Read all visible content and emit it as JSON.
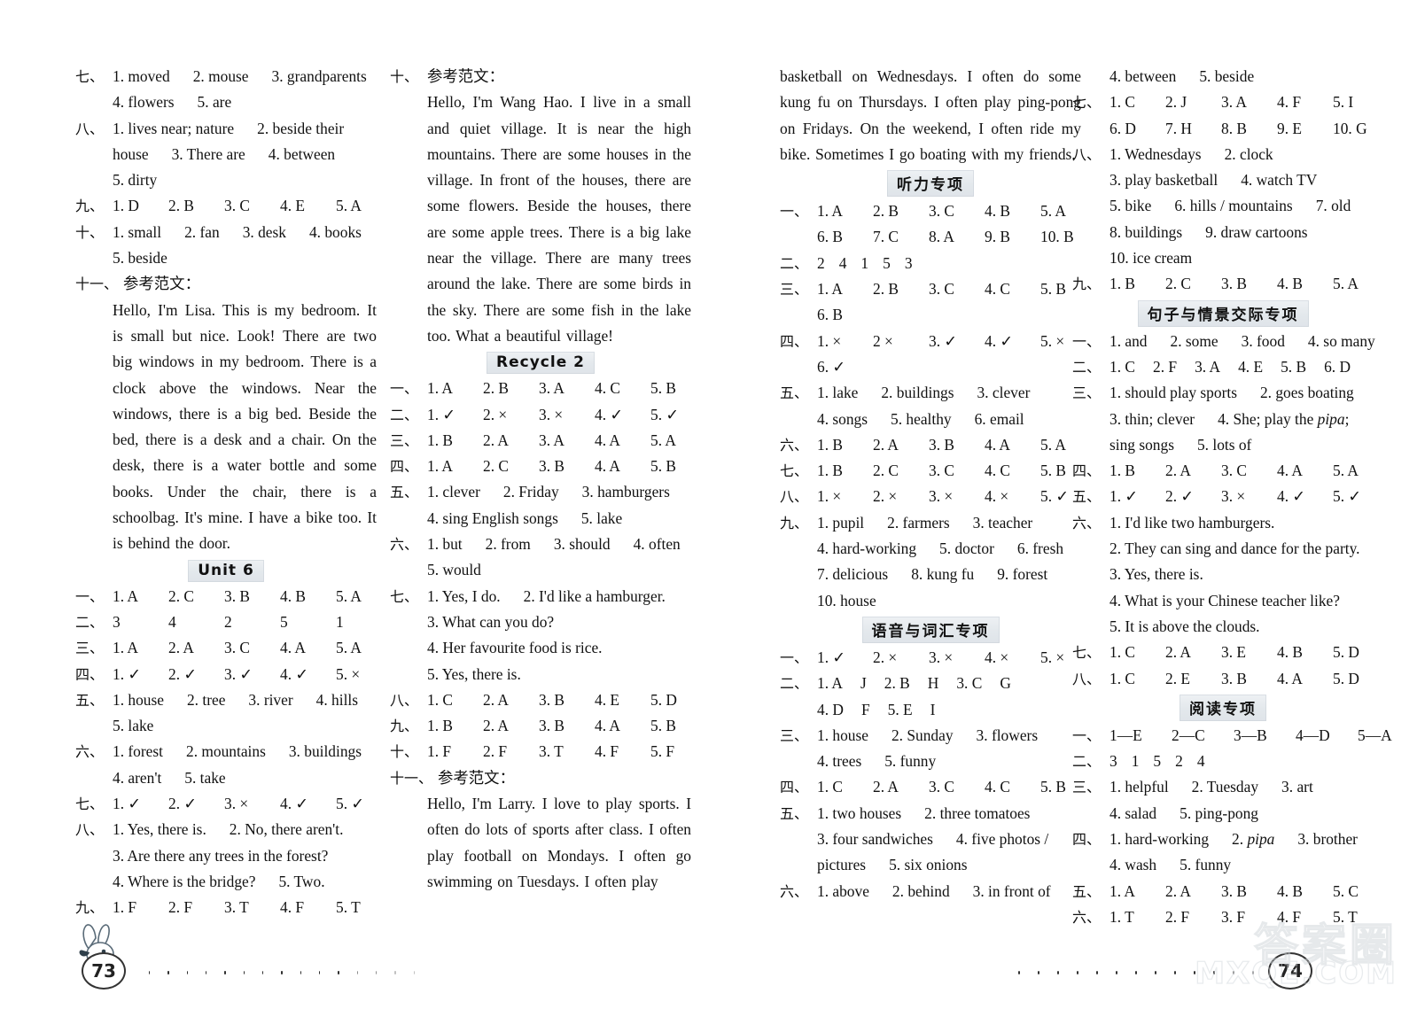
{
  "document": {
    "type": "answer-key",
    "page_left": "73",
    "page_right": "74",
    "watermark_cn": "答案圈",
    "watermark_en": "MXQE.COM"
  },
  "col1": {
    "blocks": [
      {
        "num": "七、",
        "items": [
          "1. moved",
          "2. mouse",
          "3. grandparents"
        ],
        "spacing": "free"
      },
      {
        "cont": true,
        "items": [
          "4. flowers",
          "5. are"
        ],
        "spacing": "free"
      },
      {
        "num": "八、",
        "items": [
          "1. lives near; nature",
          "2. beside their"
        ],
        "spacing": "free"
      },
      {
        "cont": true,
        "items": [
          "house",
          "3. There are",
          "4. between"
        ],
        "spacing": "free"
      },
      {
        "cont": true,
        "items": [
          "5. dirty"
        ],
        "spacing": "free"
      },
      {
        "num": "九、",
        "items": [
          "1. D",
          "2. B",
          "3. C",
          "4. E",
          "5. A"
        ],
        "spacing": "sp5"
      },
      {
        "num": "十、",
        "items": [
          "1. small",
          "2. fan",
          "3. desk",
          "4. books"
        ],
        "spacing": "free"
      },
      {
        "cont": true,
        "items": [
          "5. beside"
        ],
        "spacing": "free"
      },
      {
        "num": "十一、",
        "items": [
          "参考范文："
        ],
        "spacing": "free",
        "wide": true
      }
    ],
    "essay": "Hello, I'm Lisa. This is my bedroom. It is small but nice. Look! There are two big windows in my bedroom. There is a clock above the windows. Near the windows, there is a big bed. Beside the bed, there is a desk and a chair. On the desk, there is a water bottle and some books. Under the chair, there is a schoolbag. It's mine. I have a bike too. It is behind the door.",
    "heading": "Unit 6",
    "blocks2": [
      {
        "num": "一、",
        "items": [
          "1. A",
          "2. C",
          "3. B",
          "4. B",
          "5. A"
        ],
        "spacing": "sp5"
      },
      {
        "num": "二、",
        "items": [
          "3",
          "4",
          "2",
          "5",
          "1"
        ],
        "spacing": "sp5"
      },
      {
        "num": "三、",
        "items": [
          "1. A",
          "2. A",
          "3. C",
          "4. A",
          "5. A"
        ],
        "spacing": "sp5"
      },
      {
        "num": "四、",
        "items": [
          "1. ✓",
          "2. ✓",
          "3. ✓",
          "4. ✓",
          "5. ×"
        ],
        "spacing": "sp5"
      },
      {
        "num": "五、",
        "items": [
          "1. house",
          "2. tree",
          "3. river",
          "4. hills"
        ],
        "spacing": "free"
      },
      {
        "cont": true,
        "items": [
          "5. lake"
        ],
        "spacing": "free"
      },
      {
        "num": "六、",
        "items": [
          "1. forest",
          "2. mountains",
          "3. buildings"
        ],
        "spacing": "free"
      },
      {
        "cont": true,
        "items": [
          "4. aren't",
          "5. take"
        ],
        "spacing": "free"
      },
      {
        "num": "七、",
        "items": [
          "1. ✓",
          "2. ✓",
          "3. ×",
          "4. ✓",
          "5. ✓"
        ],
        "spacing": "sp5"
      },
      {
        "num": "八、",
        "items": [
          "1. Yes, there is.",
          "2. No, there aren't."
        ],
        "spacing": "free"
      },
      {
        "cont": true,
        "items": [
          "3. Are there any trees in the forest?"
        ],
        "spacing": "free"
      },
      {
        "cont": true,
        "items": [
          "4. Where is the bridge?",
          "5. Two."
        ],
        "spacing": "free"
      },
      {
        "num": "九、",
        "items": [
          "1. F",
          "2. F",
          "3. T",
          "4. F",
          "5. T"
        ],
        "spacing": "sp5"
      }
    ]
  },
  "col2": {
    "blocks": [
      {
        "num": "十、",
        "items": [
          "参考范文："
        ],
        "spacing": "free"
      }
    ],
    "essay": "Hello, I'm Wang Hao. I live in a small and quiet village. It is near the high mountains. There are some houses in the village. In front of the houses, there are some flowers. Beside the houses, there are some apple trees. There is a big lake near the village. There are many trees around the lake. There are some birds in the sky. There are some fish in the lake too. What a beautiful village!",
    "heading": "Recycle 2",
    "blocks2": [
      {
        "num": "一、",
        "items": [
          "1. A",
          "2. B",
          "3. A",
          "4. C",
          "5. B"
        ],
        "spacing": "sp5"
      },
      {
        "num": "二、",
        "items": [
          "1. ✓",
          "2. ×",
          "3. ×",
          "4. ✓",
          "5. ✓"
        ],
        "spacing": "sp5"
      },
      {
        "num": "三、",
        "items": [
          "1. B",
          "2. A",
          "3. A",
          "4. A",
          "5. A"
        ],
        "spacing": "sp5"
      },
      {
        "num": "四、",
        "items": [
          "1. A",
          "2. C",
          "3. B",
          "4. A",
          "5. B"
        ],
        "spacing": "sp5"
      },
      {
        "num": "五、",
        "items": [
          "1. clever",
          "2. Friday",
          "3. hamburgers"
        ],
        "spacing": "free"
      },
      {
        "cont": true,
        "items": [
          "4. sing English songs",
          "5. lake"
        ],
        "spacing": "free"
      },
      {
        "num": "六、",
        "items": [
          "1. but",
          "2. from",
          "3. should",
          "4. often"
        ],
        "spacing": "free"
      },
      {
        "cont": true,
        "items": [
          "5. would"
        ],
        "spacing": "free"
      },
      {
        "num": "七、",
        "items": [
          "1. Yes, I do.",
          "2. I'd like a hamburger."
        ],
        "spacing": "free"
      },
      {
        "cont": true,
        "items": [
          "3. What can you do?"
        ],
        "spacing": "free"
      },
      {
        "cont": true,
        "items": [
          "4. Her favourite food is rice."
        ],
        "spacing": "free"
      },
      {
        "cont": true,
        "items": [
          "5. Yes, there is."
        ],
        "spacing": "free"
      },
      {
        "num": "八、",
        "items": [
          "1. C",
          "2. A",
          "3. B",
          "4. E",
          "5. D"
        ],
        "spacing": "sp5"
      },
      {
        "num": "九、",
        "items": [
          "1. B",
          "2. A",
          "3. B",
          "4. A",
          "5. B"
        ],
        "spacing": "sp5"
      },
      {
        "num": "十、",
        "items": [
          "1. F",
          "2. F",
          "3. T",
          "4. F",
          "5. F"
        ],
        "spacing": "sp5"
      },
      {
        "num": "十一、",
        "items": [
          "参考范文："
        ],
        "spacing": "free",
        "wide": true
      }
    ],
    "essay2": "Hello, I'm Larry. I love to play sports. I often do lots of sports after class. I often play football on Mondays. I often go swimming on Tuesdays. I often play"
  },
  "col3": {
    "essay_cont": "basketball on Wednesdays. I often do some kung fu on Thursdays. I often play ping-pong on Fridays. On the weekend, I often ride my bike. Sometimes I go boating with my friends.",
    "heading1": "听力专项",
    "blocks": [
      {
        "num": "一、",
        "items": [
          "1. A",
          "2. B",
          "3. C",
          "4. B",
          "5. A"
        ],
        "spacing": "sp5"
      },
      {
        "cont": true,
        "items": [
          "6. B",
          "7. C",
          "8. A",
          "9. B",
          "10. B"
        ],
        "spacing": "sp5"
      },
      {
        "num": "二、",
        "items": [
          "2",
          "4",
          "1",
          "5",
          "3"
        ],
        "spacing": "tight"
      },
      {
        "num": "三、",
        "items": [
          "1. A",
          "2. B",
          "3. C",
          "4. C",
          "5. B"
        ],
        "spacing": "sp5"
      },
      {
        "cont": true,
        "items": [
          "6. B"
        ],
        "spacing": "free"
      },
      {
        "num": "四、",
        "items": [
          "1. ×",
          "2 ×",
          "3. ✓",
          "4. ✓",
          "5. ×"
        ],
        "spacing": "sp5"
      },
      {
        "cont": true,
        "items": [
          "6. ✓"
        ],
        "spacing": "free"
      },
      {
        "num": "五、",
        "items": [
          "1. lake",
          "2. buildings",
          "3. clever"
        ],
        "spacing": "free"
      },
      {
        "cont": true,
        "items": [
          "4. songs",
          "5. healthy",
          "6. email"
        ],
        "spacing": "free"
      },
      {
        "num": "六、",
        "items": [
          "1. B",
          "2. A",
          "3. B",
          "4. A",
          "5. A"
        ],
        "spacing": "sp5"
      },
      {
        "num": "七、",
        "items": [
          "1. B",
          "2. C",
          "3. C",
          "4. C",
          "5. B"
        ],
        "spacing": "sp5"
      },
      {
        "num": "八、",
        "items": [
          "1. ×",
          "2. ×",
          "3. ×",
          "4. ×",
          "5. ✓"
        ],
        "spacing": "sp5"
      },
      {
        "num": "九、",
        "items": [
          "1. pupil",
          "2. farmers",
          "3. teacher"
        ],
        "spacing": "free"
      },
      {
        "cont": true,
        "items": [
          "4. hard-working",
          "5. doctor",
          "6. fresh"
        ],
        "spacing": "free"
      },
      {
        "cont": true,
        "items": [
          "7. delicious",
          "8. kung fu",
          "9. forest"
        ],
        "spacing": "free"
      },
      {
        "cont": true,
        "items": [
          "10. house"
        ],
        "spacing": "free"
      }
    ],
    "heading2": "语音与词汇专项",
    "blocks2": [
      {
        "num": "一、",
        "items": [
          "1. ✓",
          "2. ×",
          "3. ×",
          "4. ×",
          "5. ×"
        ],
        "spacing": "sp5"
      },
      {
        "num": "二、",
        "items": [
          "1. A",
          "J",
          "2. B",
          "H",
          "3. C",
          "G"
        ],
        "spacing": "free2"
      },
      {
        "cont": true,
        "items": [
          "4. D",
          "F",
          "5. E",
          "I"
        ],
        "spacing": "free2"
      },
      {
        "num": "三、",
        "items": [
          "1. house",
          "2. Sunday",
          "3. flowers"
        ],
        "spacing": "free"
      },
      {
        "cont": true,
        "items": [
          "4. trees",
          "5. funny"
        ],
        "spacing": "free"
      },
      {
        "num": "四、",
        "items": [
          "1. C",
          "2. A",
          "3. C",
          "4. C",
          "5. B"
        ],
        "spacing": "sp5"
      },
      {
        "num": "五、",
        "items": [
          "1. two houses",
          "2. three tomatoes"
        ],
        "spacing": "free"
      },
      {
        "cont": true,
        "items": [
          "3. four sandwiches",
          "4. five photos /"
        ],
        "spacing": "free"
      },
      {
        "cont": true,
        "items": [
          "pictures",
          "5. six onions"
        ],
        "spacing": "free"
      },
      {
        "num": "六、",
        "items": [
          "1. above",
          "2. behind",
          "3. in front of"
        ],
        "spacing": "free"
      }
    ]
  },
  "col4": {
    "blocks": [
      {
        "cont": true,
        "items": [
          "4. between",
          "5. beside"
        ],
        "spacing": "free"
      },
      {
        "num": "七、",
        "items": [
          "1. C",
          "2. J",
          "3. A",
          "4. F",
          "5. I"
        ],
        "spacing": "sp5"
      },
      {
        "cont": true,
        "items": [
          "6. D",
          "7. H",
          "8. B",
          "9. E",
          "10. G"
        ],
        "spacing": "sp5"
      },
      {
        "num": "八、",
        "items": [
          "1. Wednesdays",
          "2. clock"
        ],
        "spacing": "free"
      },
      {
        "cont": true,
        "items": [
          "3. play basketball",
          "4. watch TV"
        ],
        "spacing": "free"
      },
      {
        "cont": true,
        "items": [
          "5. bike",
          "6. hills / mountains",
          "7. old"
        ],
        "spacing": "free"
      },
      {
        "cont": true,
        "items": [
          "8. buildings",
          "9. draw cartoons"
        ],
        "spacing": "free"
      },
      {
        "cont": true,
        "items": [
          "10. ice cream"
        ],
        "spacing": "free"
      },
      {
        "num": "九、",
        "items": [
          "1. B",
          "2. C",
          "3. B",
          "4. B",
          "5. A"
        ],
        "spacing": "sp5"
      }
    ],
    "heading1": "句子与情景交际专项",
    "blocks2": [
      {
        "num": "一、",
        "items": [
          "1. and",
          "2. some",
          "3. food",
          "4. so many"
        ],
        "spacing": "free"
      },
      {
        "num": "二、",
        "items": [
          "1. C",
          "2. F",
          "3. A",
          "4. E",
          "5. B",
          "6. D"
        ],
        "spacing": "free2"
      },
      {
        "num": "三、",
        "items": [
          "1. should play sports",
          "2. goes boating"
        ],
        "spacing": "free"
      },
      {
        "cont": true,
        "items": [
          "3. thin; clever",
          "4. She; play the pipa;"
        ],
        "spacing": "free",
        "italic_word": "pipa"
      },
      {
        "cont": true,
        "items": [
          "sing songs",
          "5. lots of"
        ],
        "spacing": "free"
      },
      {
        "num": "四、",
        "items": [
          "1. B",
          "2. A",
          "3. C",
          "4. A",
          "5. A"
        ],
        "spacing": "sp5"
      },
      {
        "num": "五、",
        "items": [
          "1. ✓",
          "2. ✓",
          "3. ×",
          "4. ✓",
          "5. ✓"
        ],
        "spacing": "sp5"
      },
      {
        "num": "六、",
        "items": [
          "1. I'd like two hamburgers."
        ],
        "spacing": "free"
      },
      {
        "cont": true,
        "items": [
          "2. They can sing and dance for the party."
        ],
        "spacing": "free"
      },
      {
        "cont": true,
        "items": [
          "3. Yes, there is."
        ],
        "spacing": "free"
      },
      {
        "cont": true,
        "items": [
          "4. What is your Chinese teacher like?"
        ],
        "spacing": "free"
      },
      {
        "cont": true,
        "items": [
          "5. It is above the clouds."
        ],
        "spacing": "free"
      },
      {
        "num": "七、",
        "items": [
          "1. C",
          "2. A",
          "3. E",
          "4. B",
          "5. D"
        ],
        "spacing": "sp5"
      },
      {
        "num": "八、",
        "items": [
          "1. C",
          "2. E",
          "3. B",
          "4. A",
          "5. D"
        ],
        "spacing": "sp5"
      }
    ],
    "heading2": "阅读专项",
    "blocks3": [
      {
        "num": "一、",
        "items": [
          "1—E",
          "2—C",
          "3—B",
          "4—D",
          "5—A"
        ],
        "spacing": "sp5w"
      },
      {
        "num": "二、",
        "items": [
          "3",
          "1",
          "5",
          "2",
          "4"
        ],
        "spacing": "tight"
      },
      {
        "num": "三、",
        "items": [
          "1. helpful",
          "2. Tuesday",
          "3. art"
        ],
        "spacing": "free"
      },
      {
        "cont": true,
        "items": [
          "4. salad",
          "5. ping-pong"
        ],
        "spacing": "free"
      },
      {
        "num": "四、",
        "items": [
          "1. hard-working",
          "2. pipa",
          "3. brother"
        ],
        "spacing": "free",
        "italic_word": "pipa"
      },
      {
        "cont": true,
        "items": [
          "4. wash",
          "5. funny"
        ],
        "spacing": "free"
      },
      {
        "num": "五、",
        "items": [
          "1. A",
          "2. A",
          "3. B",
          "4. B",
          "5. C"
        ],
        "spacing": "sp5"
      },
      {
        "num": "六、",
        "items": [
          "1. T",
          "2. F",
          "3. F",
          "4. F",
          "5. T"
        ],
        "spacing": "sp5"
      }
    ]
  }
}
